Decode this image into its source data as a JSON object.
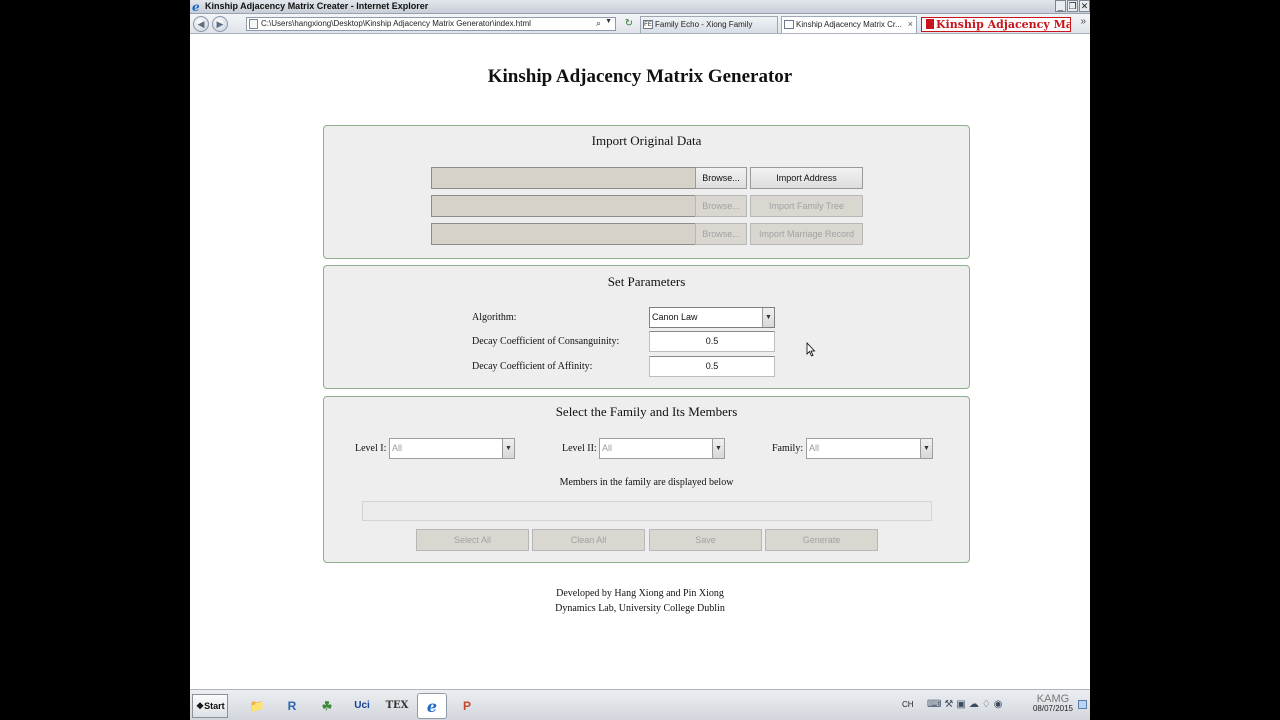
{
  "window": {
    "title": "Kinship Adjacency Matrix Creater - Internet Explorer",
    "minimize": "_",
    "maximize": "❐",
    "close": "✕"
  },
  "browser": {
    "url": "C:\\Users\\hangxiong\\Desktop\\Kinship Adjacency Matrix Generator\\index.html",
    "tabs": [
      {
        "label": "Family Echo - Xiong Family",
        "icon_text": "FE"
      },
      {
        "label": "Kinship Adjacency Matrix Cr...",
        "close": "×"
      }
    ],
    "brand": "Kinship Adjacency Matrix Generator"
  },
  "page": {
    "title": "Kinship Adjacency Matrix Generator",
    "import_section": {
      "title": "Import Original Data",
      "rows": [
        {
          "browse": "Browse...",
          "action": "Import Address"
        },
        {
          "browse": "Browse...",
          "action": "Import Family Tree"
        },
        {
          "browse": "Browse...",
          "action": "Import Marriage Record"
        }
      ]
    },
    "params_section": {
      "title": "Set Parameters",
      "algorithm_label": "Algorithm:",
      "algorithm_value": "Canon Law",
      "consanguinity_label": "Decay Coefficient of Consanguinity:",
      "consanguinity_value": "0.5",
      "affinity_label": "Decay Coefficient of Affinity:",
      "affinity_value": "0.5"
    },
    "family_section": {
      "title": "Select the Family and Its Members",
      "level1_label": "Level I:",
      "level1_value": "All",
      "level2_label": "Level II:",
      "level2_value": "All",
      "family_label": "Family:",
      "family_value": "All",
      "members_note": "Members in the family are displayed below",
      "buttons": {
        "select_all": "Select All",
        "clean_all": "Clean All",
        "save": "Save",
        "generate": "Generate"
      }
    },
    "footer": {
      "line1": "Developed by Hang Xiong and Pin Xiong",
      "line2": "Dynamics Lab, University College Dublin"
    }
  },
  "taskbar": {
    "start": "Start",
    "apps": [
      {
        "icon": "folder-icon",
        "glyph": "📁"
      },
      {
        "icon": "r-icon",
        "glyph": "R"
      },
      {
        "icon": "evernote-icon",
        "glyph": "☘"
      },
      {
        "icon": "ucinet-icon",
        "glyph": "Uci"
      },
      {
        "icon": "tex-icon",
        "glyph": "TEX"
      },
      {
        "icon": "ie-icon",
        "glyph": "e"
      },
      {
        "icon": "powerpoint-icon",
        "glyph": "P"
      }
    ],
    "language": "CH",
    "clock_label": "KAMG",
    "date": "08/07/2015"
  }
}
